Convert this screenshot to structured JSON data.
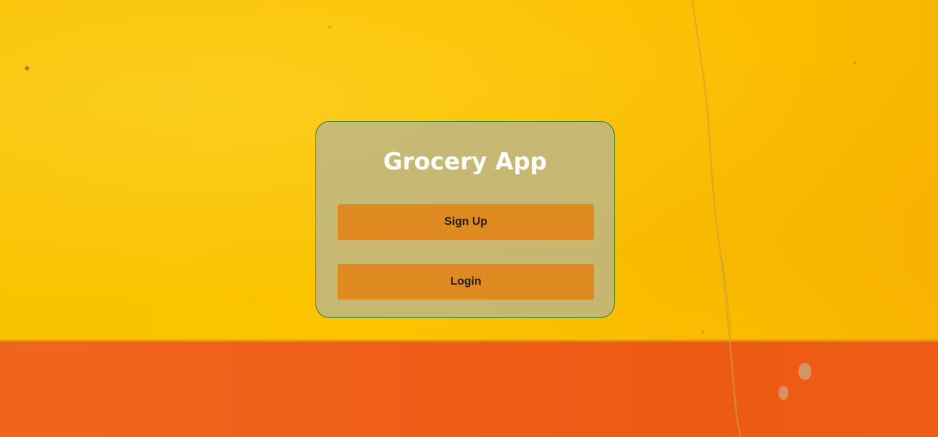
{
  "app": {
    "title": "Grocery App"
  },
  "actions": {
    "signup_label": "Sign Up",
    "login_label": "Login"
  },
  "colors": {
    "wall_yellow": "#fcc400",
    "wall_orange": "#ef5f18",
    "card_background": "rgba(180,180,150,0.75)",
    "card_border": "#2c7a1e",
    "button_background": "#df8a20",
    "title_text": "#ffffff",
    "button_text": "#1f1f1f"
  }
}
